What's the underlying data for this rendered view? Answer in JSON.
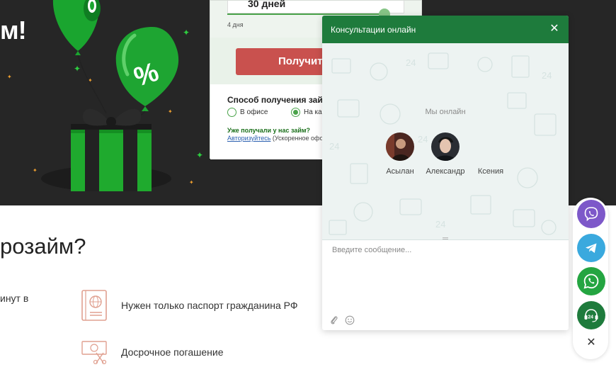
{
  "hero": {
    "title_fragment": "м!"
  },
  "loan_form": {
    "term_value": "30 дней",
    "term_min": "4 дня",
    "get_button": "Получить",
    "method_title": "Способ получения займа",
    "options": [
      "В офисе",
      "На карту"
    ],
    "selected_option": "На карту",
    "already_label": "Уже получали у нас займ?",
    "auth_link": "Авторизуйтесь",
    "auth_suffix": " (Ускоренное оформление)"
  },
  "content": {
    "heading_fragment": "розайм?",
    "left_fragment": "инут в",
    "features": [
      {
        "icon": "passport-icon",
        "text": "Нужен только паспорт гражданина РФ"
      },
      {
        "icon": "early-repayment-icon",
        "text": "Досрочное погашение"
      }
    ]
  },
  "chat": {
    "title": "Консультации онлайн",
    "online_label": "Мы онлайн",
    "operators": [
      "Асылан",
      "Александр",
      "Ксения"
    ],
    "input_placeholder": "Введите сообщение...",
    "header_color": "#1e7b3c"
  },
  "messengers": [
    {
      "name": "viber-icon",
      "color": "#7d58c9"
    },
    {
      "name": "telegram-icon",
      "color": "#3aa9de"
    },
    {
      "name": "whatsapp-icon",
      "color": "#24a541"
    },
    {
      "name": "support-24-icon",
      "color": "#1e7b3c"
    }
  ]
}
